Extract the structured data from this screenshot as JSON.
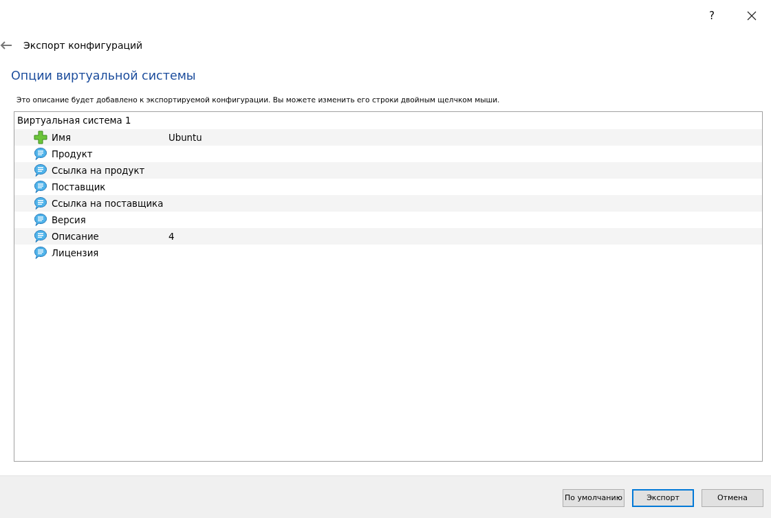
{
  "window": {
    "help": "?"
  },
  "header": {
    "title": "Экспорт конфигураций"
  },
  "heading": "Опции виртуальной системы",
  "description": "Это описание будет добавлено к экспортируемой конфигурации. Вы можете изменить его строки двойным щелчком мыши.",
  "tree": {
    "label": "Виртуальная система 1",
    "children": [
      {
        "kind": "required",
        "label": "Имя",
        "value": "Ubuntu"
      },
      {
        "kind": "optional",
        "label": "Продукт"
      },
      {
        "kind": "optional",
        "label": "Ссылка на продукт"
      },
      {
        "kind": "optional",
        "label": "Поставщик"
      },
      {
        "kind": "optional",
        "label": "Ссылка на поставщика"
      },
      {
        "kind": "optional",
        "label": "Версия"
      },
      {
        "kind": "optional",
        "label": "Описание",
        "value": "4"
      },
      {
        "kind": "optional",
        "label": "Лицензия"
      }
    ]
  },
  "buttons": [
    {
      "label": "По умолчанию",
      "default": false
    },
    {
      "label": "Экспорт",
      "default": true
    },
    {
      "label": "Отмена",
      "default": false
    }
  ]
}
